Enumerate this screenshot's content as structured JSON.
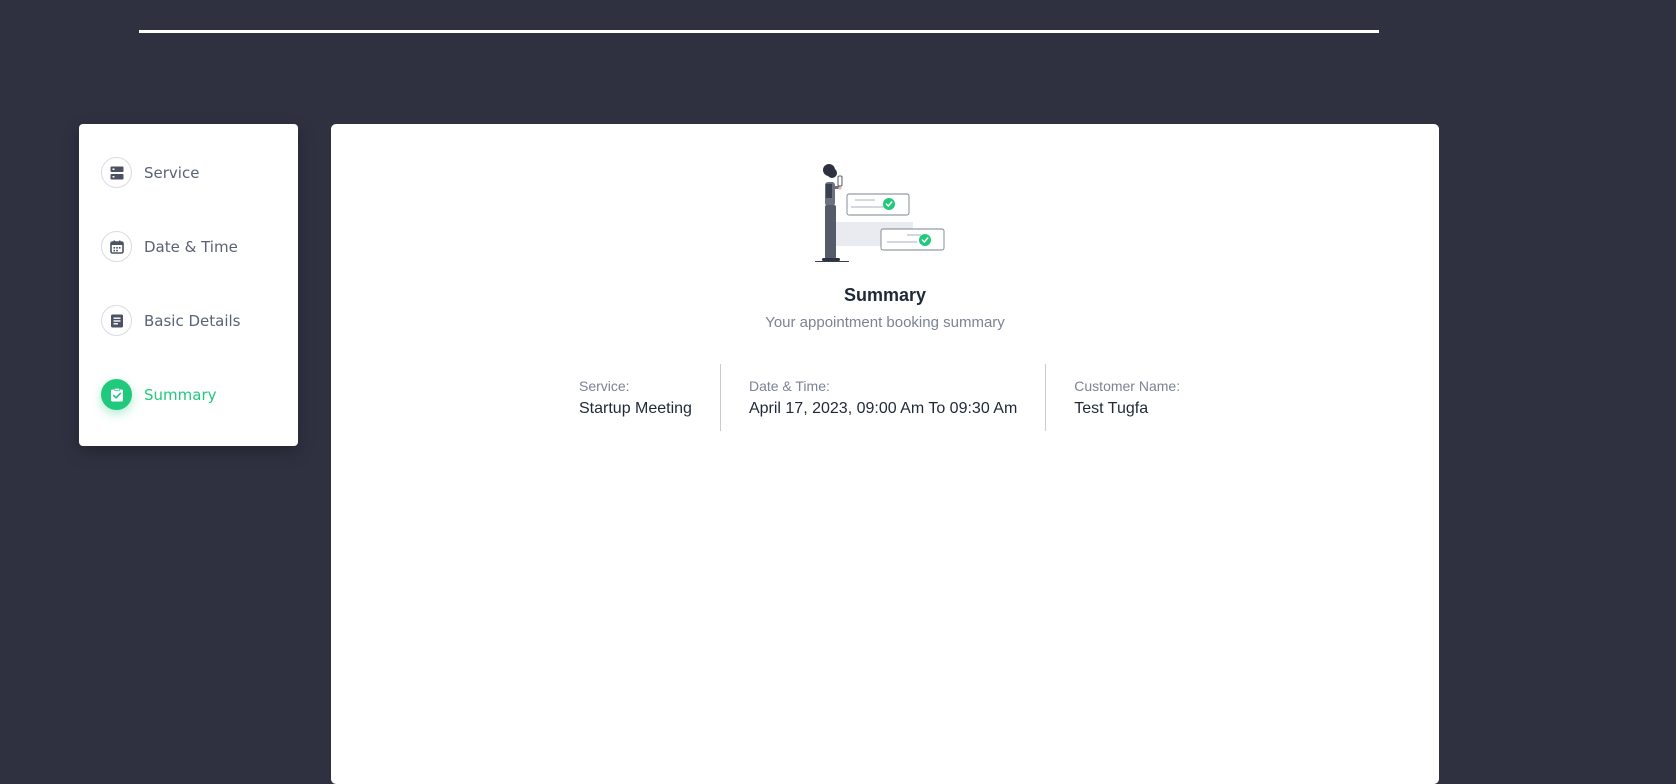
{
  "steps": [
    {
      "label": "Service",
      "icon": "server-icon",
      "active": false
    },
    {
      "label": "Date & Time",
      "icon": "calendar-icon",
      "active": false
    },
    {
      "label": "Basic Details",
      "icon": "document-icon",
      "active": false
    },
    {
      "label": "Summary",
      "icon": "clipboard-check-icon",
      "active": true
    }
  ],
  "summary": {
    "title": "Summary",
    "subtitle": "Your appointment booking summary",
    "details": [
      {
        "label": "Service:",
        "value": "Startup Meeting"
      },
      {
        "label": "Date & Time:",
        "value": "April 17, 2023, 09:00 Am To 09:30 Am"
      },
      {
        "label": "Customer Name:",
        "value": "Test Tugfa"
      }
    ]
  },
  "colors": {
    "background": "#2f3141",
    "accent": "#20c97c",
    "icon": "#4b5263"
  }
}
